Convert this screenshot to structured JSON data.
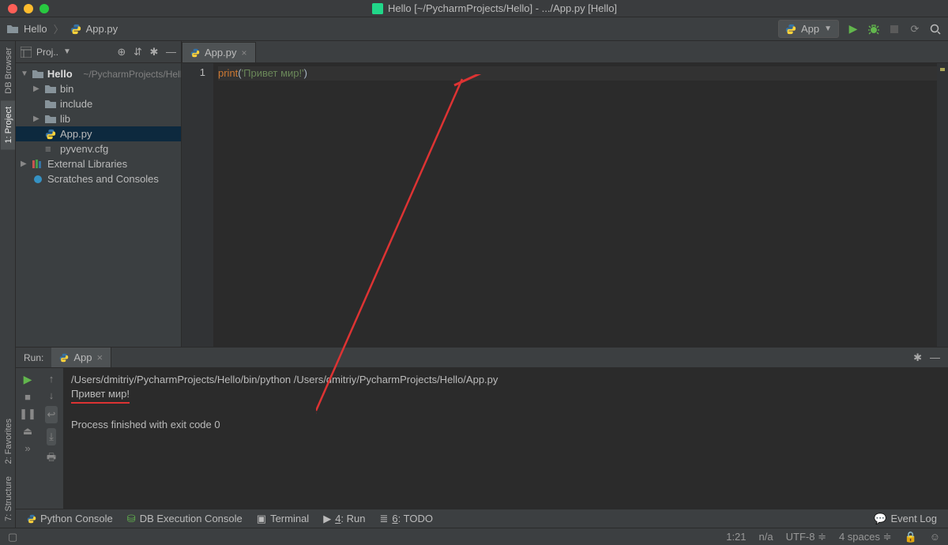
{
  "window_title": "Hello [~/PycharmProjects/Hello] - .../App.py [Hello]",
  "breadcrumb": {
    "root": "Hello",
    "file": "App.py"
  },
  "run_config": {
    "name": "App"
  },
  "project": {
    "header": "Proj..",
    "root": {
      "name": "Hello",
      "path": "~/PycharmProjects/Hello"
    },
    "children": [
      "bin",
      "include",
      "lib",
      "App.py",
      "pyvenv.cfg"
    ],
    "external": "External Libraries",
    "scratches": "Scratches and Consoles"
  },
  "editor": {
    "tab": "App.py",
    "line_no": "1",
    "code_kw": "print",
    "code_open": "(",
    "code_str": "'Привет мир!'",
    "code_close": ")"
  },
  "run": {
    "label": "Run:",
    "tab": "App",
    "cmd": "/Users/dmitriy/PycharmProjects/Hello/bin/python /Users/dmitriy/PycharmProjects/Hello/App.py",
    "output": "Привет мир!",
    "exit": "Process finished with exit code 0"
  },
  "bottom_tabs": {
    "python_console": "Python Console",
    "db_console": "DB Execution Console",
    "terminal": "Terminal",
    "run": "4: Run",
    "todo": "6: TODO",
    "event_log": "Event Log"
  },
  "left_tabs": {
    "db_browser": "DB Browser",
    "project": "1: Project",
    "favorites": "2: Favorites",
    "structure": "7: Structure"
  },
  "status": {
    "pos": "1:21",
    "lf": "n/a",
    "encoding": "UTF-8",
    "spaces": "4 spaces"
  }
}
